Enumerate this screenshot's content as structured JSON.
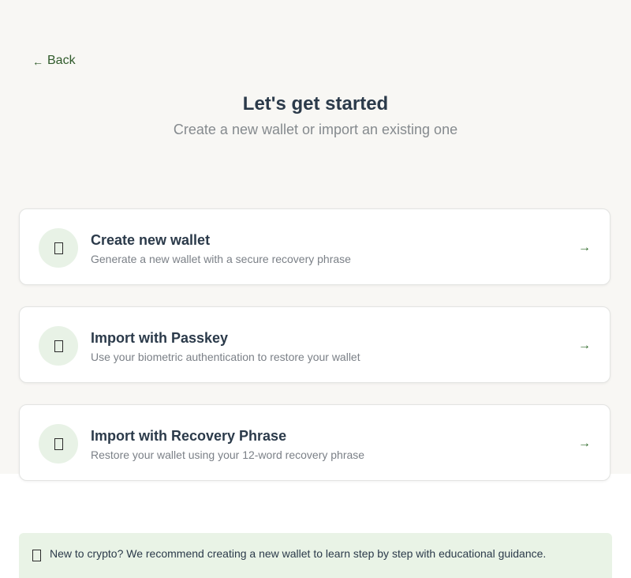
{
  "nav": {
    "back_label": "Back",
    "back_arrow": "←"
  },
  "header": {
    "title": "Let's get started",
    "subtitle": "Create a new wallet or import an existing one"
  },
  "options": [
    {
      "title": "Create new wallet",
      "description": "Generate a new wallet with a secure recovery phrase",
      "icon": "wallet-icon",
      "arrow": "→"
    },
    {
      "title": "Import with Passkey",
      "description": "Use your biometric authentication to restore your wallet",
      "icon": "passkey-icon",
      "arrow": "→"
    },
    {
      "title": "Import with Recovery Phrase",
      "description": "Restore your wallet using your 12-word recovery phrase",
      "icon": "recovery-phrase-icon",
      "arrow": "→"
    }
  ],
  "tip": {
    "icon": "lightbulb-icon",
    "text": "New to crypto? We recommend creating a new wallet to learn step by step with educational guidance."
  },
  "colors": {
    "accent_green": "#2f5a2a",
    "icon_background": "#e8f2e6",
    "tip_background": "#e9f3e6",
    "page_background": "#f8f7f4"
  }
}
